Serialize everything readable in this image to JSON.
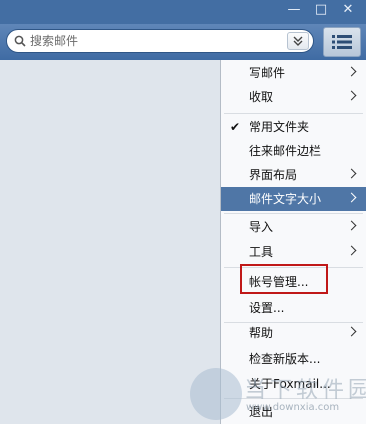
{
  "window": {
    "minimize_glyph": "—",
    "maximize_glyph": "□",
    "close_glyph": "✕"
  },
  "search": {
    "placeholder": "搜索邮件",
    "dropdown_glyph": "⌄"
  },
  "menu": {
    "items": [
      {
        "label": "写邮件",
        "submenu": true,
        "checked": false
      },
      {
        "label": "收取",
        "submenu": true,
        "checked": false
      },
      {
        "label": "常用文件夹",
        "submenu": false,
        "checked": true,
        "check_glyph": "✔"
      },
      {
        "label": "往来邮件边栏",
        "submenu": false,
        "checked": false
      },
      {
        "label": "界面布局",
        "submenu": true,
        "checked": false
      },
      {
        "label": "邮件文字大小",
        "submenu": true,
        "checked": false,
        "highlighted": true
      },
      {
        "label": "导入",
        "submenu": true,
        "checked": false
      },
      {
        "label": "工具",
        "submenu": true,
        "checked": false
      },
      {
        "label": "帐号管理...",
        "submenu": false,
        "checked": false,
        "emphasized": true
      },
      {
        "label": "设置...",
        "submenu": false,
        "checked": false
      },
      {
        "label": "帮助",
        "submenu": true,
        "checked": false
      },
      {
        "label": "检查新版本...",
        "submenu": false,
        "checked": false
      },
      {
        "label": "关于Foxmail...",
        "submenu": false,
        "checked": false
      },
      {
        "label": "退出",
        "submenu": false,
        "checked": false
      }
    ]
  },
  "watermark": {
    "text": "当下软件园",
    "url": "www.downxia.com"
  },
  "colors": {
    "titlebar": "#436ea3",
    "highlight": "#4f76a6",
    "emphasis_box": "#c01818"
  }
}
